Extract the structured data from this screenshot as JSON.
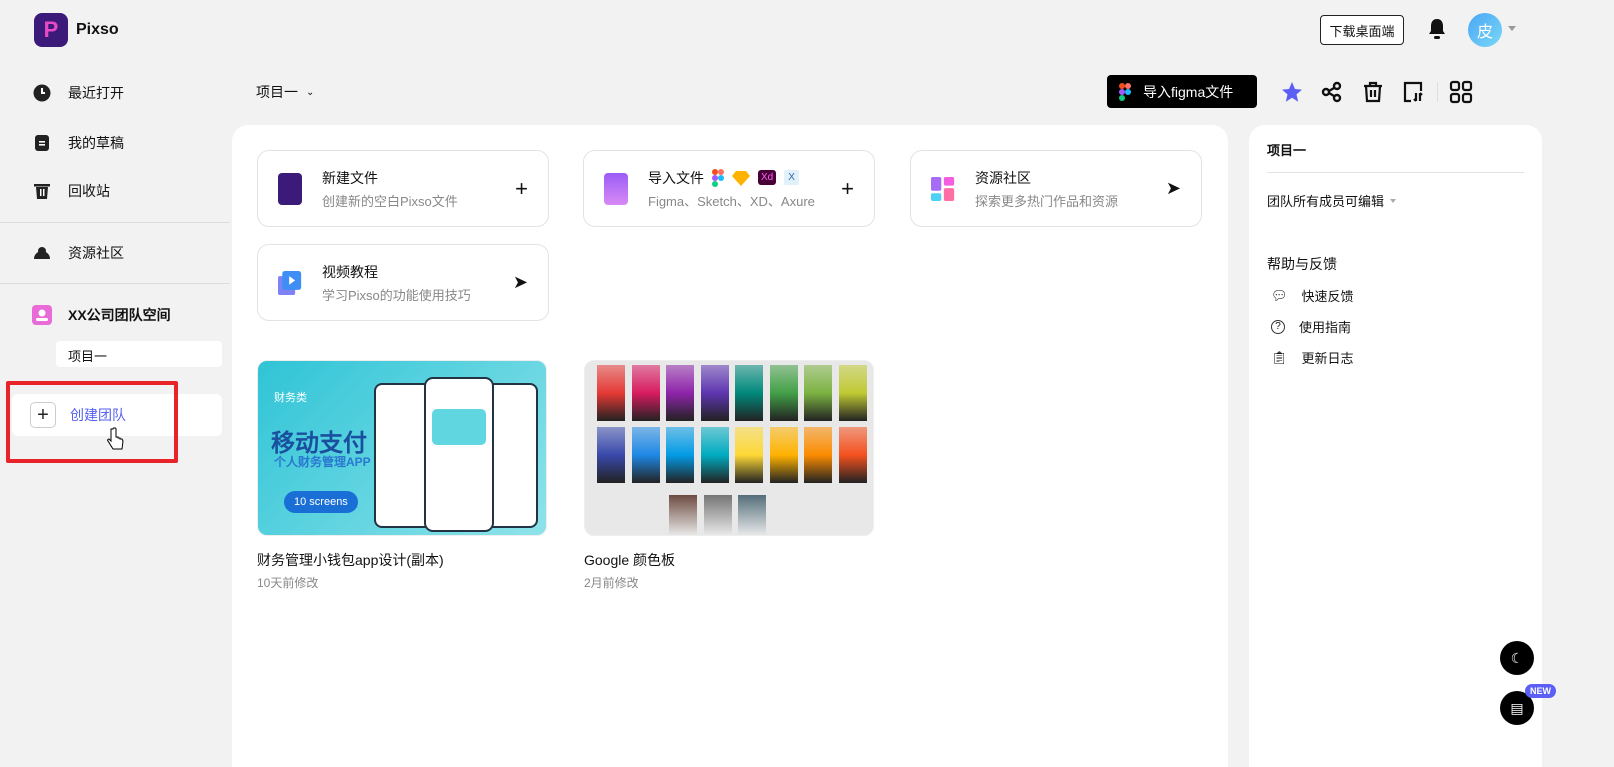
{
  "app": {
    "name": "Pixso",
    "logo_letter": "P"
  },
  "header": {
    "download_label": "下载桌面端",
    "avatar_text": "皮"
  },
  "sidebar": {
    "items": [
      {
        "label": "最近打开"
      },
      {
        "label": "我的草稿"
      },
      {
        "label": "回收站"
      },
      {
        "label": "资源社区"
      }
    ],
    "team": {
      "name": "XX公司团队空间",
      "project": "项目一"
    },
    "create_team": "创建团队"
  },
  "toolbar": {
    "project": "项目一",
    "import_figma": "导入figma文件"
  },
  "cards": [
    {
      "title": "新建文件",
      "subtitle": "创建新的空白Pixso文件",
      "action": "+"
    },
    {
      "title": "导入文件",
      "subtitle": "Figma、Sketch、XD、Axure",
      "action": "+",
      "badges": [
        "Xd",
        "X"
      ]
    },
    {
      "title": "资源社区",
      "subtitle": "探索更多热门作品和资源",
      "action": "➤"
    },
    {
      "title": "视频教程",
      "subtitle": "学习Pixso的功能使用技巧",
      "action": "➤"
    }
  ],
  "files": [
    {
      "name": "财务管理小钱包app设计(副本)",
      "modified": "10天前修改",
      "thumb": {
        "tag": "财务类",
        "title": "移动支付",
        "subtitle": "个人财务管理APP",
        "button": "10 screens"
      }
    },
    {
      "name": "Google 颜色板",
      "modified": "2月前修改",
      "palette": [
        "#e53935",
        "#d81b60",
        "#8e24aa",
        "#5e35b1",
        "#00897b",
        "#43a047",
        "#7cb342",
        "#c0ca33",
        "#3949ab",
        "#1e88e5",
        "#039be5",
        "#00acc1",
        "#fdd835",
        "#ffb300",
        "#fb8c00",
        "#f4511e"
      ],
      "palette_bottom": [
        "#6d4c41",
        "#757575",
        "#546e7a"
      ]
    }
  ],
  "right_panel": {
    "project": "项目一",
    "permission": "团队所有成员可编辑",
    "help_title": "帮助与反馈",
    "help_items": [
      {
        "label": "快速反馈"
      },
      {
        "label": "使用指南"
      },
      {
        "label": "更新日志"
      }
    ]
  },
  "fabs": {
    "new_badge": "NEW"
  }
}
